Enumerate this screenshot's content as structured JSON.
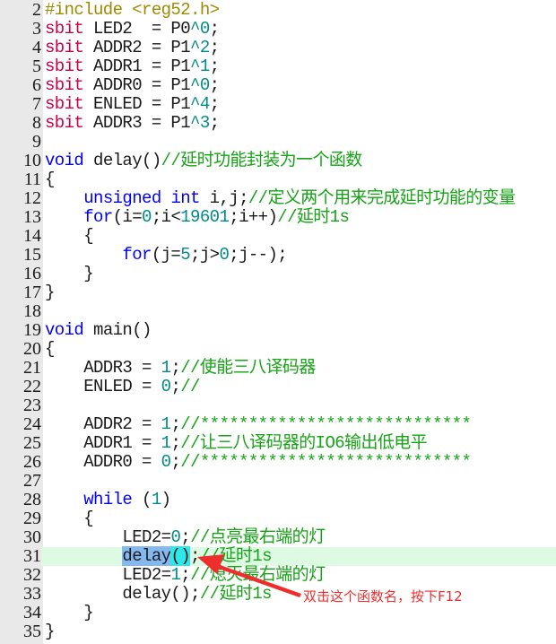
{
  "editor": {
    "language": "C (8051)",
    "current_line": 31,
    "selection": {
      "line": 31,
      "text": "delay",
      "matched_brackets": "()"
    },
    "lines": [
      {
        "n": "2",
        "tokens": [
          {
            "t": "#include <reg52.h>",
            "c": "pp"
          }
        ]
      },
      {
        "n": "3",
        "tokens": [
          {
            "t": "sbit",
            "c": "ty"
          },
          {
            "t": " LED2  = P0"
          },
          {
            "t": "^0",
            "c": "num"
          },
          {
            "t": ";"
          }
        ]
      },
      {
        "n": "4",
        "tokens": [
          {
            "t": "sbit",
            "c": "ty"
          },
          {
            "t": " ADDR2 = P1"
          },
          {
            "t": "^2",
            "c": "num"
          },
          {
            "t": ";"
          }
        ]
      },
      {
        "n": "5",
        "tokens": [
          {
            "t": "sbit",
            "c": "ty"
          },
          {
            "t": " ADDR1 = P1"
          },
          {
            "t": "^1",
            "c": "num"
          },
          {
            "t": ";"
          }
        ]
      },
      {
        "n": "6",
        "tokens": [
          {
            "t": "sbit",
            "c": "ty"
          },
          {
            "t": " ADDR0 = P1"
          },
          {
            "t": "^0",
            "c": "num"
          },
          {
            "t": ";"
          }
        ]
      },
      {
        "n": "7",
        "tokens": [
          {
            "t": "sbit",
            "c": "ty"
          },
          {
            "t": " ENLED = P1"
          },
          {
            "t": "^4",
            "c": "num"
          },
          {
            "t": ";"
          }
        ]
      },
      {
        "n": "8",
        "tokens": [
          {
            "t": "sbit",
            "c": "ty"
          },
          {
            "t": " ADDR3 = P1"
          },
          {
            "t": "^3",
            "c": "num"
          },
          {
            "t": ";"
          }
        ]
      },
      {
        "n": "9",
        "tokens": []
      },
      {
        "n": "10",
        "tokens": [
          {
            "t": "void",
            "c": "kw"
          },
          {
            "t": " delay()"
          },
          {
            "t": "//延时功能封装为一个函数",
            "c": "cm"
          }
        ]
      },
      {
        "n": "11",
        "tokens": [
          {
            "t": "{"
          }
        ]
      },
      {
        "n": "12",
        "tokens": [
          {
            "t": "    "
          },
          {
            "t": "unsigned",
            "c": "kw"
          },
          {
            "t": " "
          },
          {
            "t": "int",
            "c": "kw"
          },
          {
            "t": " i,j;"
          },
          {
            "t": "//定义两个用来完成延时功能的变量",
            "c": "cm"
          }
        ]
      },
      {
        "n": "13",
        "tokens": [
          {
            "t": "    "
          },
          {
            "t": "for",
            "c": "kw"
          },
          {
            "t": "(i="
          },
          {
            "t": "0",
            "c": "num"
          },
          {
            "t": ";i<"
          },
          {
            "t": "19601",
            "c": "num"
          },
          {
            "t": ";i++)"
          },
          {
            "t": "//延时1s",
            "c": "cm"
          }
        ]
      },
      {
        "n": "14",
        "tokens": [
          {
            "t": "    {"
          }
        ]
      },
      {
        "n": "15",
        "tokens": [
          {
            "t": "        "
          },
          {
            "t": "for",
            "c": "kw"
          },
          {
            "t": "(j="
          },
          {
            "t": "5",
            "c": "num"
          },
          {
            "t": ";j>"
          },
          {
            "t": "0",
            "c": "num"
          },
          {
            "t": ";j--);"
          }
        ]
      },
      {
        "n": "16",
        "tokens": [
          {
            "t": "    }"
          }
        ]
      },
      {
        "n": "17",
        "tokens": [
          {
            "t": "}"
          }
        ]
      },
      {
        "n": "18",
        "tokens": []
      },
      {
        "n": "19",
        "tokens": [
          {
            "t": "void",
            "c": "kw"
          },
          {
            "t": " main()"
          }
        ]
      },
      {
        "n": "20",
        "tokens": [
          {
            "t": "{"
          }
        ]
      },
      {
        "n": "21",
        "tokens": [
          {
            "t": "    ADDR3 = "
          },
          {
            "t": "1",
            "c": "num"
          },
          {
            "t": ";"
          },
          {
            "t": "//使能三八译码器",
            "c": "cm"
          }
        ]
      },
      {
        "n": "22",
        "tokens": [
          {
            "t": "    ENLED = "
          },
          {
            "t": "0",
            "c": "num"
          },
          {
            "t": ";"
          },
          {
            "t": "//",
            "c": "cm"
          }
        ]
      },
      {
        "n": "23",
        "tokens": []
      },
      {
        "n": "24",
        "tokens": [
          {
            "t": "    ADDR2 = "
          },
          {
            "t": "1",
            "c": "num"
          },
          {
            "t": ";"
          },
          {
            "t": "//****************************",
            "c": "cm"
          }
        ]
      },
      {
        "n": "25",
        "tokens": [
          {
            "t": "    ADDR1 = "
          },
          {
            "t": "1",
            "c": "num"
          },
          {
            "t": ";"
          },
          {
            "t": "//让三八译码器的IO6输出低电平",
            "c": "cm"
          }
        ]
      },
      {
        "n": "26",
        "tokens": [
          {
            "t": "    ADDR0 = "
          },
          {
            "t": "0",
            "c": "num"
          },
          {
            "t": ";"
          },
          {
            "t": "//****************************",
            "c": "cm"
          }
        ]
      },
      {
        "n": "27",
        "tokens": []
      },
      {
        "n": "28",
        "tokens": [
          {
            "t": "    "
          },
          {
            "t": "while",
            "c": "kw"
          },
          {
            "t": " ("
          },
          {
            "t": "1",
            "c": "num"
          },
          {
            "t": ")"
          }
        ]
      },
      {
        "n": "29",
        "tokens": [
          {
            "t": "    {"
          }
        ]
      },
      {
        "n": "30",
        "tokens": [
          {
            "t": "        LED2="
          },
          {
            "t": "0",
            "c": "num"
          },
          {
            "t": ";"
          },
          {
            "t": "//点亮最右端的灯",
            "c": "cm"
          }
        ]
      },
      {
        "n": "31",
        "tokens": [
          {
            "t": "        "
          },
          {
            "t": "delay",
            "c": "sel"
          },
          {
            "t": "()",
            "c": "brace"
          },
          {
            "t": ";"
          },
          {
            "t": "//延时1s",
            "c": "cm"
          }
        ]
      },
      {
        "n": "32",
        "tokens": [
          {
            "t": "        LED2="
          },
          {
            "t": "1",
            "c": "num"
          },
          {
            "t": ";"
          },
          {
            "t": "//熄灭最右端的灯",
            "c": "cm"
          }
        ]
      },
      {
        "n": "33",
        "tokens": [
          {
            "t": "        delay();"
          },
          {
            "t": "//延时1s",
            "c": "cm"
          }
        ]
      },
      {
        "n": "34",
        "tokens": [
          {
            "t": "    }"
          }
        ]
      },
      {
        "n": "35",
        "tokens": [
          {
            "t": "}"
          }
        ]
      }
    ]
  },
  "annotation": {
    "note": "双击这个函数名，按下F12",
    "arrow_color": "#f02d2d",
    "points_to": "delay() on line 31"
  },
  "colors": {
    "keyword": "#0000ff",
    "preprocessor": "#9b8a00",
    "type": "#c8004a",
    "number": "#008a8a",
    "comment": "#16a316",
    "current_line_bg": "#ddfbe3",
    "selection_bg": "#86b8f0",
    "bracket_match_bg": "#2ee8e8",
    "gutter_bg": "#e9e9e9"
  }
}
